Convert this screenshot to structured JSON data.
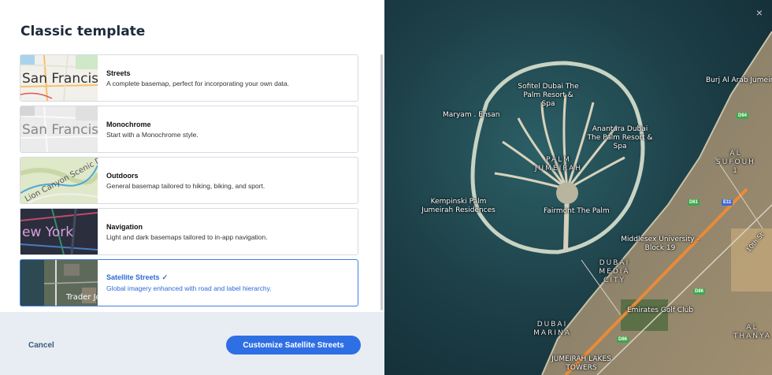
{
  "panel": {
    "title": "Classic template"
  },
  "templates": [
    {
      "thumb": "San Francisco",
      "title": "Streets",
      "desc": "A complete basemap, perfect for incorporating your own data.",
      "selected": false
    },
    {
      "thumb": "San Francisco",
      "title": "Monochrome",
      "desc": "Start with a Monochrome style.",
      "selected": false
    },
    {
      "thumb": "Lion Canyon Scenic Dr",
      "title": "Outdoors",
      "desc": "General basemap tailored to hiking, biking, and sport.",
      "selected": false
    },
    {
      "thumb": "ew York",
      "title": "Navigation",
      "desc": "Light and dark basemaps tailored to in-app navigation.",
      "selected": false
    },
    {
      "thumb": "Trader Jo",
      "title": "Satellite Streets",
      "desc": "Global imagery enhanced with road and label hierarchy.",
      "selected": true
    }
  ],
  "footer": {
    "cancel": "Cancel",
    "customize": "Customize Satellite Streets"
  },
  "map": {
    "close": "×",
    "labels": {
      "sofitel": "Sofitel Dubai The Palm Resort & Spa",
      "maryam": "Maryam . Ehsan",
      "anantara": "Anantara Dubai The Palm Resort & Spa",
      "palm": "PALM JUMEIRAH",
      "kempinski": "Kempinski Palm Jumeirah Residences",
      "fairmont": "Fairmont The Palm",
      "burj": "Burj Al Arab Jumeira",
      "sufouh": "AL SUFOUH 1",
      "middlesex": "Middlesex University - Block 19",
      "mediacity": "DUBAI MEDIA CITY",
      "golf": "Emirates Golf Club",
      "marina": "DUBAI MARINA",
      "thanya": "AL THANYA",
      "lakes": "JUMEIRAH LAKES TOWERS",
      "tenth": "10th St"
    },
    "shields": {
      "d94": "D94",
      "d61": "D61",
      "e11": "E11",
      "d86a": "D86",
      "d86b": "D86"
    }
  }
}
